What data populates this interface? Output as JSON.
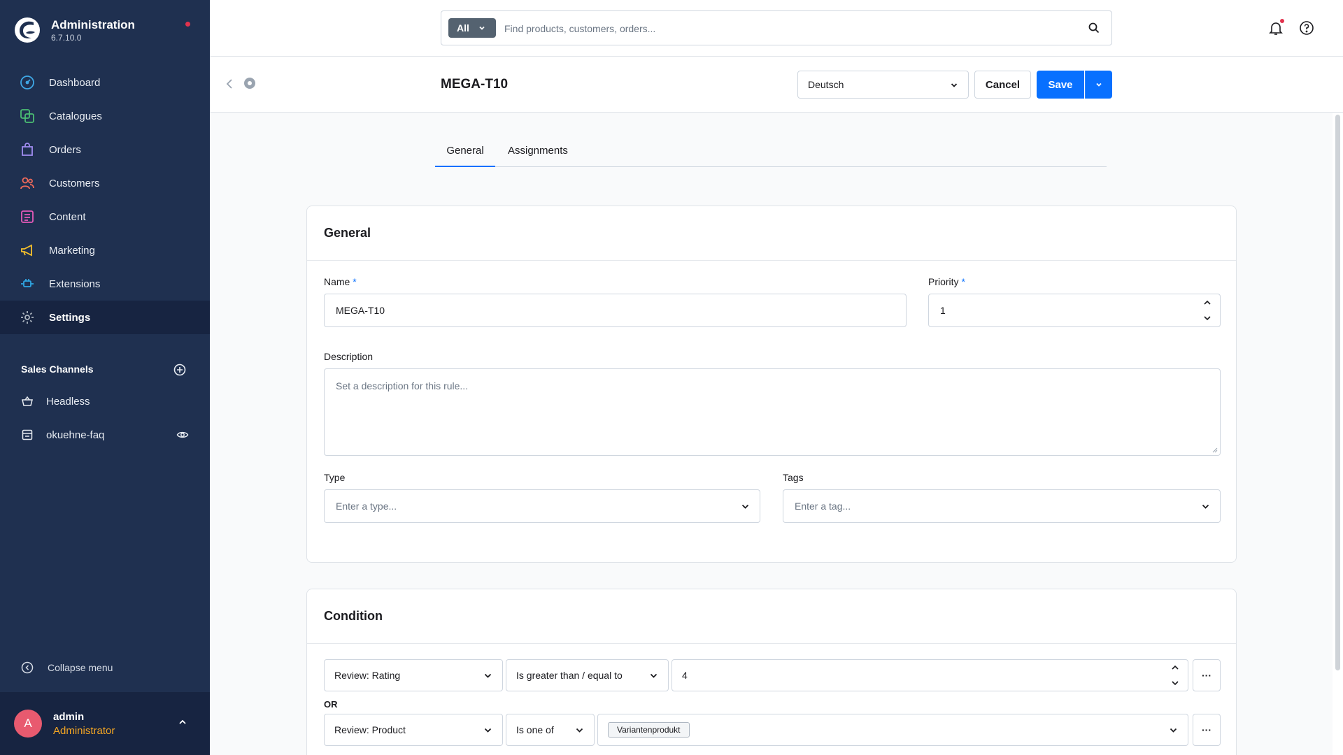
{
  "app": {
    "title": "Administration",
    "version": "6.7.10.0"
  },
  "nav": [
    {
      "label": "Dashboard",
      "icon": "dashboard-icon",
      "color": "#3fa8e6"
    },
    {
      "label": "Catalogues",
      "icon": "catalogue-icon",
      "color": "#4bbd73"
    },
    {
      "label": "Orders",
      "icon": "orders-icon",
      "color": "#a28df2"
    },
    {
      "label": "Customers",
      "icon": "customers-icon",
      "color": "#f26b5b"
    },
    {
      "label": "Content",
      "icon": "content-icon",
      "color": "#e45ab9"
    },
    {
      "label": "Marketing",
      "icon": "marketing-icon",
      "color": "#f5c02b"
    },
    {
      "label": "Extensions",
      "icon": "extensions-icon",
      "color": "#2fa6e3"
    },
    {
      "label": "Settings",
      "icon": "settings-icon",
      "color": "#aeb7c2",
      "active": true
    }
  ],
  "sales_channels": {
    "heading": "Sales Channels",
    "items": [
      {
        "label": "Headless",
        "icon": "basket-icon"
      },
      {
        "label": "okuehne-faq",
        "icon": "storefront-icon"
      }
    ]
  },
  "sidebar_footer": {
    "collapse_label": "Collapse menu"
  },
  "user": {
    "initial": "A",
    "name": "admin",
    "role": "Administrator"
  },
  "search": {
    "scope": "All",
    "placeholder": "Find products, customers, orders..."
  },
  "header": {
    "title": "MEGA-T10",
    "language": "Deutsch",
    "cancel_label": "Cancel",
    "save_label": "Save"
  },
  "tabs": [
    {
      "label": "General",
      "active": true
    },
    {
      "label": "Assignments"
    }
  ],
  "general": {
    "title": "General",
    "name_label": "Name",
    "name_value": "MEGA-T10",
    "priority_label": "Priority",
    "priority_value": "1",
    "required_mark": "*",
    "description_label": "Description",
    "description_placeholder": "Set a description for this rule...",
    "type_label": "Type",
    "type_placeholder": "Enter a type...",
    "tags_label": "Tags",
    "tags_placeholder": "Enter a tag..."
  },
  "condition": {
    "title": "Condition",
    "or_label": "OR",
    "rows": [
      {
        "field": "Review: Rating",
        "operator": "Is greater than / equal to",
        "value": "4"
      },
      {
        "field": "Review: Product",
        "operator": "Is one of",
        "tag": "Variantenprodukt"
      }
    ],
    "more_label": "···"
  },
  "colors": {
    "sidebar": "#1f3050",
    "sidebar_active": "#172441",
    "primary": "#0870ff",
    "role": "#f5a623",
    "avatar": "#e85a6f"
  }
}
